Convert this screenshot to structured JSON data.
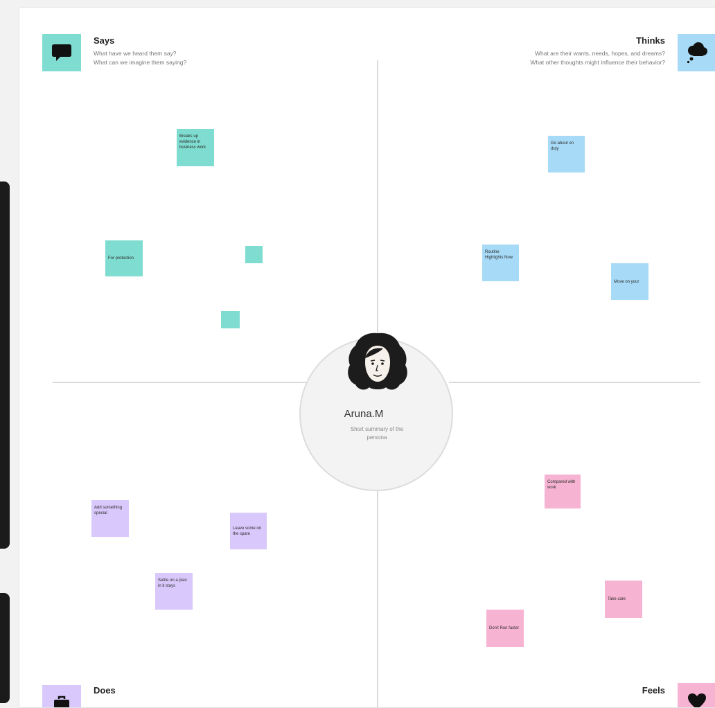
{
  "colors": {
    "says": "#7fdcd0",
    "thinks": "#a6daf6",
    "does": "#d8c8fb",
    "feels": "#f7b3d2"
  },
  "quadrants": {
    "says": {
      "title": "Says",
      "subtitle_1": "What have we heard them say?",
      "subtitle_2": "What can we imagine them saying?",
      "icon": "speech-bubble-icon"
    },
    "thinks": {
      "title": "Thinks",
      "subtitle_1": "What are their wants, needs, hopes, and dreams?",
      "subtitle_2": "What other thoughts might influence their behavior?",
      "icon": "thought-cloud-icon"
    },
    "does": {
      "title": "Does",
      "icon": "briefcase-icon"
    },
    "feels": {
      "title": "Feels",
      "icon": "heart-icon"
    }
  },
  "persona": {
    "name": "Aruna.M",
    "summary": "Short summary of the persona",
    "icon": "persona-avatar-icon"
  },
  "stickies": {
    "says_1": "Breaks up evidence in business work",
    "says_2": "For protection",
    "says_3": "",
    "says_4": "",
    "thinks_1": "Go about on duty",
    "thinks_2": "Routine Highlights Now",
    "thinks_3": "Move on your",
    "does_1": "Add something special",
    "does_2": "Leave some on the spare",
    "does_3": "Settle on a plan in it stays",
    "feels_1": "Compared with work",
    "feels_2": "Take care",
    "feels_3": "Don't Run faster"
  }
}
